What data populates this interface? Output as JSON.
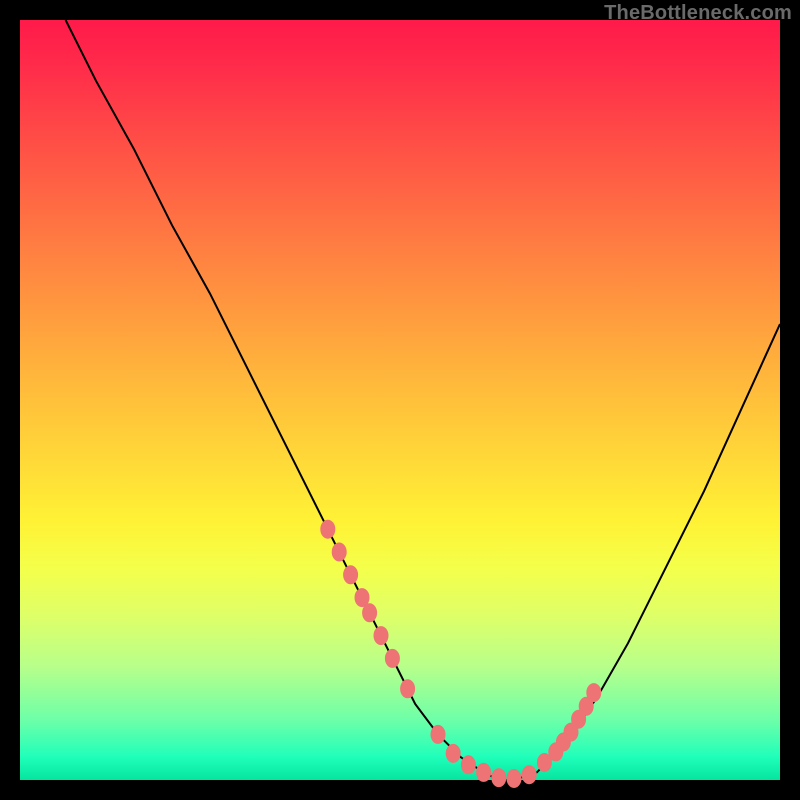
{
  "watermark": "TheBottleneck.com",
  "colors": {
    "dot": "#ed7374",
    "curve": "#000000",
    "frame": "#000000"
  },
  "chart_data": {
    "type": "line",
    "title": "",
    "xlabel": "",
    "ylabel": "",
    "xlim": [
      0,
      100
    ],
    "ylim": [
      0,
      100
    ],
    "grid": false,
    "legend": false,
    "series": [
      {
        "name": "bottleneck-curve",
        "x": [
          6,
          10,
          15,
          20,
          25,
          30,
          35,
          40,
          44,
          48,
          52,
          55,
          58,
          61,
          63,
          65,
          68,
          72,
          76,
          80,
          85,
          90,
          95,
          100
        ],
        "y": [
          100,
          92,
          83,
          73,
          64,
          54,
          44,
          34,
          26,
          18,
          10,
          6,
          3,
          1,
          0,
          0,
          1,
          5,
          11,
          18,
          28,
          38,
          49,
          60
        ]
      }
    ],
    "marker_points": {
      "name": "highlight-dots",
      "x": [
        40.5,
        42,
        43.5,
        45,
        46,
        47.5,
        49,
        51,
        55,
        57,
        59,
        61,
        63,
        65,
        67,
        69,
        70.5,
        71.5,
        72.5,
        73.5,
        74.5,
        75.5
      ],
      "y": [
        33,
        30,
        27,
        24,
        22,
        19,
        16,
        12,
        6,
        3.5,
        2,
        1,
        0.3,
        0.2,
        0.7,
        2.3,
        3.7,
        5,
        6.3,
        8,
        9.7,
        11.5
      ]
    }
  }
}
